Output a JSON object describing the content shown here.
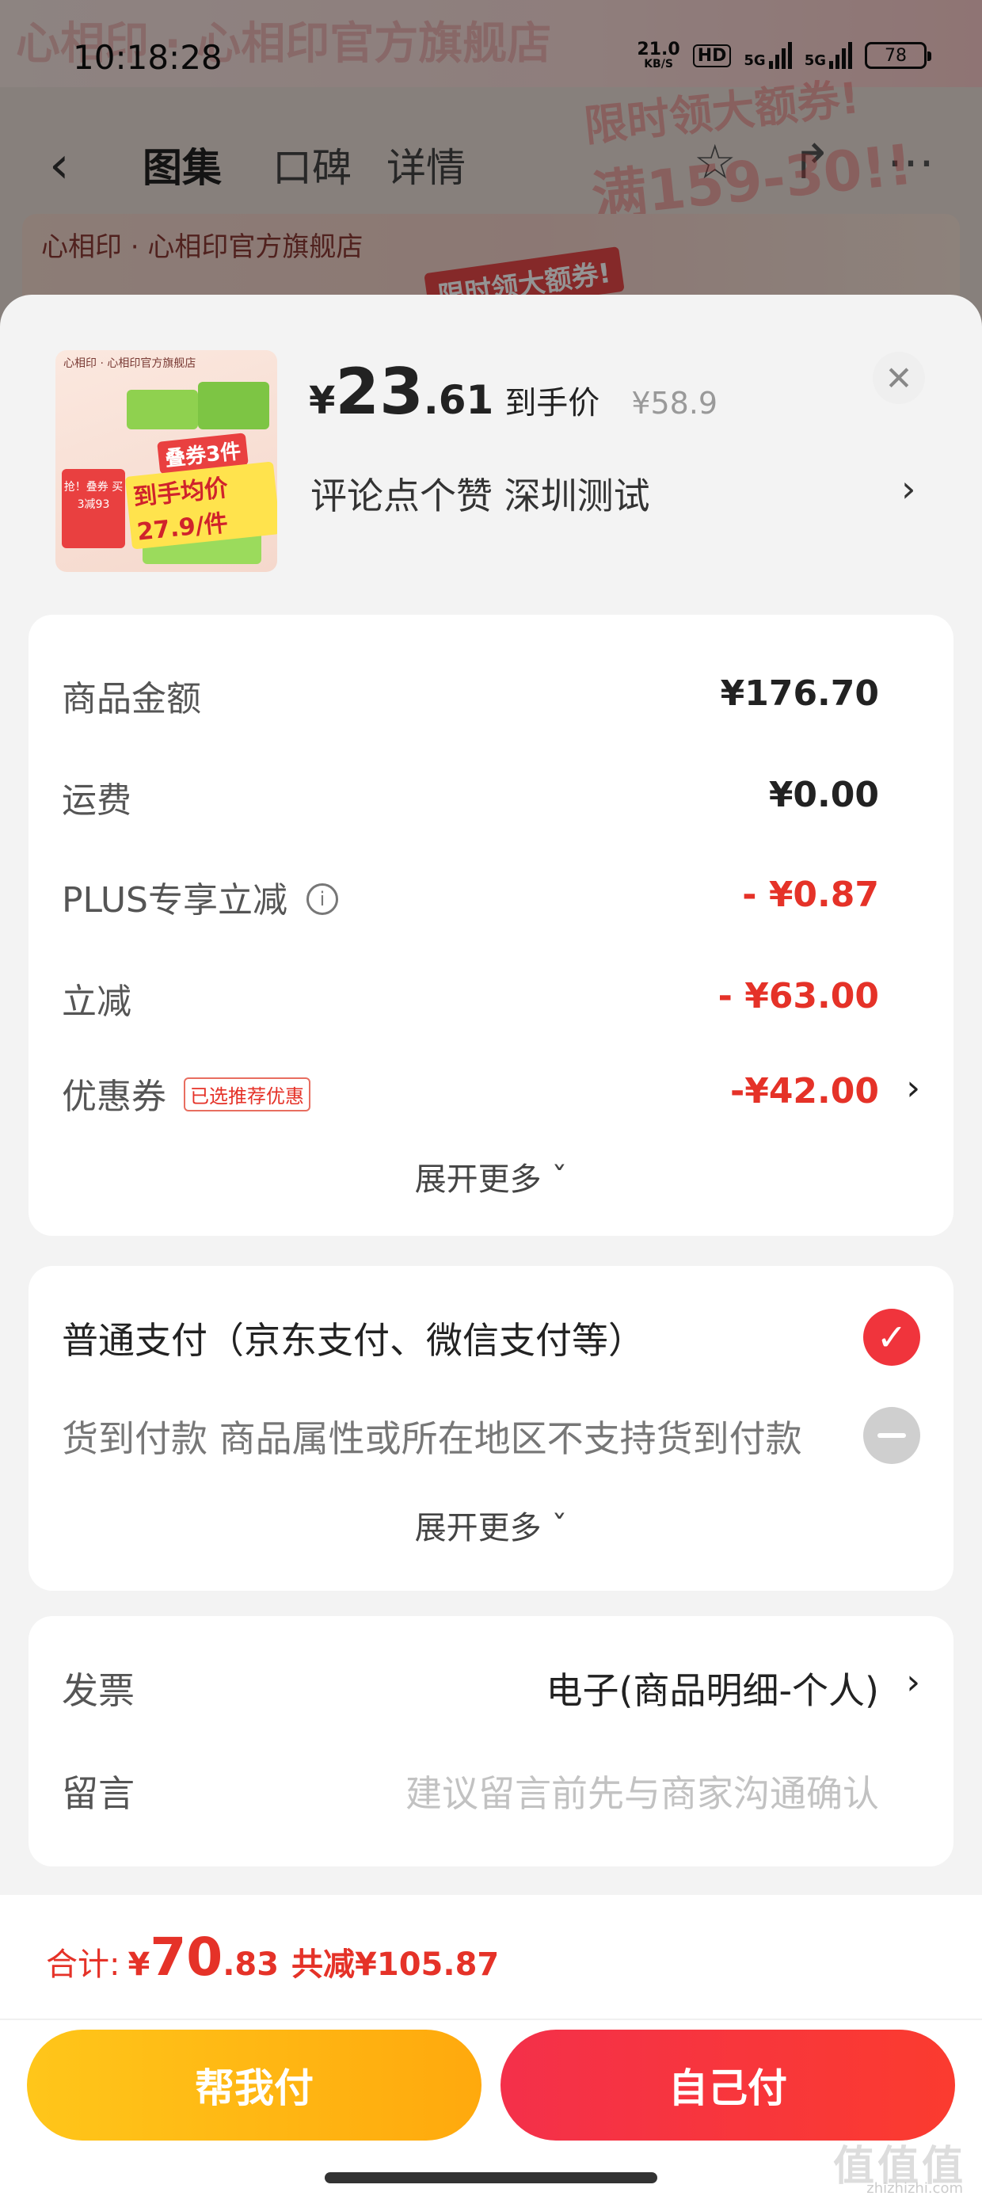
{
  "status_bar": {
    "time": "10:18:28",
    "net_speed": "21.0",
    "net_unit": "KB/S",
    "hd": "HD",
    "sig1": "5G",
    "sig2": "5G",
    "battery": "78"
  },
  "background": {
    "banner_text": "心相印 · 心相印官方旗舰店",
    "tabs": [
      "图集",
      "口碑",
      "详情"
    ],
    "store_name": "心相印 · 心相印官方旗舰店",
    "promo": "限时领大额券!",
    "promo_big": "满159-30!!"
  },
  "product": {
    "image_store": "心相印 · 心相印官方旗舰店",
    "image_tag": "叠券3件",
    "image_tag2": "到手均价27.9/件",
    "image_left": "抢！叠券 买3减93",
    "price_yen": "¥",
    "price_int": "23",
    "price_dec": ".61",
    "price_label": "到手价",
    "original_price": "¥58.9",
    "spec": "评论点个赞  深圳测试"
  },
  "amounts": {
    "rows": [
      {
        "label": "商品金额",
        "value": "¥176.70"
      },
      {
        "label": "运费",
        "value": "¥0.00"
      },
      {
        "label": "PLUS专享立减",
        "value": "- ¥0.87"
      },
      {
        "label": "立减",
        "value": "- ¥63.00"
      },
      {
        "label": "优惠券",
        "value": "-¥42.00",
        "badge": "已选推荐优惠"
      }
    ],
    "expand": "展开更多 ˇ"
  },
  "payment": {
    "normal": "普通支付（京东支付、微信支付等）",
    "cod": "货到付款  商品属性或所在地区不支持货到付款",
    "expand": "展开更多 ˇ"
  },
  "extra": {
    "invoice_label": "发票",
    "invoice_value": "电子(商品明细-个人)",
    "note_label": "留言",
    "note_placeholder": "建议留言前先与商家沟通确认"
  },
  "footer": {
    "total_label": "合计:",
    "total_yen": "¥",
    "total_int": "70",
    "total_dec": ".83",
    "total_save": "共减¥105.87",
    "help_pay": "帮我付",
    "self_pay": "自己付"
  },
  "watermark": {
    "logo": "值值值",
    "site": "zhizhizhi.com"
  },
  "colors": {
    "accent_red": "#e53228",
    "help_yellow": "#ffb714",
    "self_red": "#f4304a"
  },
  "icons": [
    "back-icon",
    "star-icon",
    "share-icon",
    "more-icon",
    "close-icon",
    "chevron-right-icon",
    "info-icon",
    "check-icon",
    "disabled-icon"
  ]
}
